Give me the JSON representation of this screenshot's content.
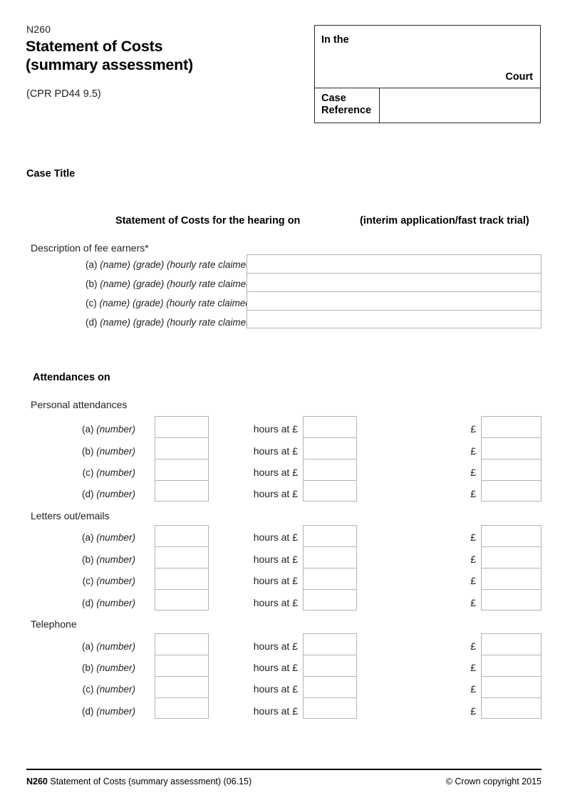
{
  "header": {
    "form_code": "N260",
    "title_line1": "Statement of Costs",
    "title_line2": "(summary assessment)",
    "subtitle": "(CPR PD44 9.5)"
  },
  "court_box": {
    "in_the_label": "In the",
    "court_label": "Court",
    "case_reference_label": "Case Reference",
    "case_reference_value": ""
  },
  "case_title_heading": "Case Title",
  "hearing": {
    "left": "Statement of Costs for the hearing on",
    "right": "(interim application/fast track trial)"
  },
  "fee_earners": {
    "heading": "Description of fee earners*",
    "rows": [
      {
        "marker": "(a)",
        "descriptor": "(name) (grade) (hourly rate claimed)",
        "value": ""
      },
      {
        "marker": "(b)",
        "descriptor": "(name) (grade) (hourly rate claimed)",
        "value": ""
      },
      {
        "marker": "(c)",
        "descriptor": "(name) (grade) (hourly rate claimed)",
        "value": ""
      },
      {
        "marker": "(d)",
        "descriptor": "(name) (grade) (hourly rate claimed)",
        "value": ""
      }
    ]
  },
  "attendances": {
    "heading": "Attendances on",
    "hours_at_label": "hours at £",
    "pound_label": "£",
    "row_markers": [
      "(a)",
      "(b)",
      "(c)",
      "(d)"
    ],
    "row_descriptor": "(number)",
    "groups": [
      {
        "heading": "Personal attendances"
      },
      {
        "heading": "Letters out/emails"
      },
      {
        "heading": "Telephone"
      }
    ]
  },
  "footer": {
    "code": "N260",
    "description": "Statement of Costs (summary assessment) (06.15)",
    "copyright": "© Crown copyright 2015"
  }
}
